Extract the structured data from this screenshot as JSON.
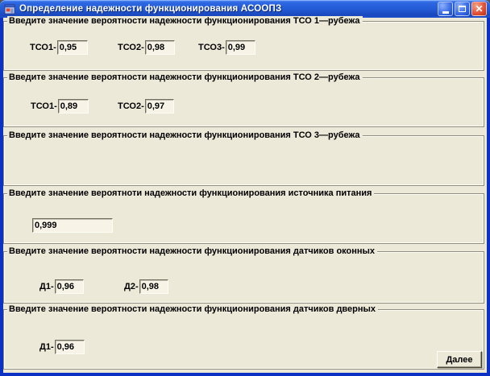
{
  "window": {
    "title": "Определение надежности функционирования АСООПЗ"
  },
  "icons": {
    "close": "✕"
  },
  "colors": {
    "titlebar_blue": "#2259d4",
    "window_border_blue": "#0c31c3",
    "client_background": "#ece9d8",
    "input_background": "#f7f4e7",
    "close_button_red": "#e3553a",
    "text_color": "#000000"
  },
  "sections": [
    {
      "header": "Введите значение вероятности надежности функционирования ТСО 1—рубежа",
      "fields": [
        {
          "label": "ТСО1-",
          "value": "0,95"
        },
        {
          "label": "ТСО2-",
          "value": "0,98"
        },
        {
          "label": "ТСО3-",
          "value": "0,99"
        }
      ]
    },
    {
      "header": "Введите значение вероятности надежности функционирования ТСО 2—рубежа",
      "fields": [
        {
          "label": "ТСО1-",
          "value": "0,89"
        },
        {
          "label": "ТСО2-",
          "value": "0,97"
        }
      ]
    },
    {
      "header": "Введите значение вероятности надежности функционирования ТСО 3—рубежа",
      "fields": []
    },
    {
      "header": "Введите значение вероятноти надежности функционирования источника питания",
      "fields": [
        {
          "label": "",
          "value": "0,999"
        }
      ]
    },
    {
      "header": "Введите значение вероятности надежности функционирования датчиков оконных",
      "fields": [
        {
          "label": "Д1-",
          "value": "0,96"
        },
        {
          "label": "Д2-",
          "value": "0,98"
        }
      ]
    },
    {
      "header": "Введите значение вероятности надежности функционирования датчиков дверных",
      "fields": [
        {
          "label": "Д1-",
          "value": "0,96"
        }
      ]
    }
  ],
  "next_button_label": "Далее"
}
